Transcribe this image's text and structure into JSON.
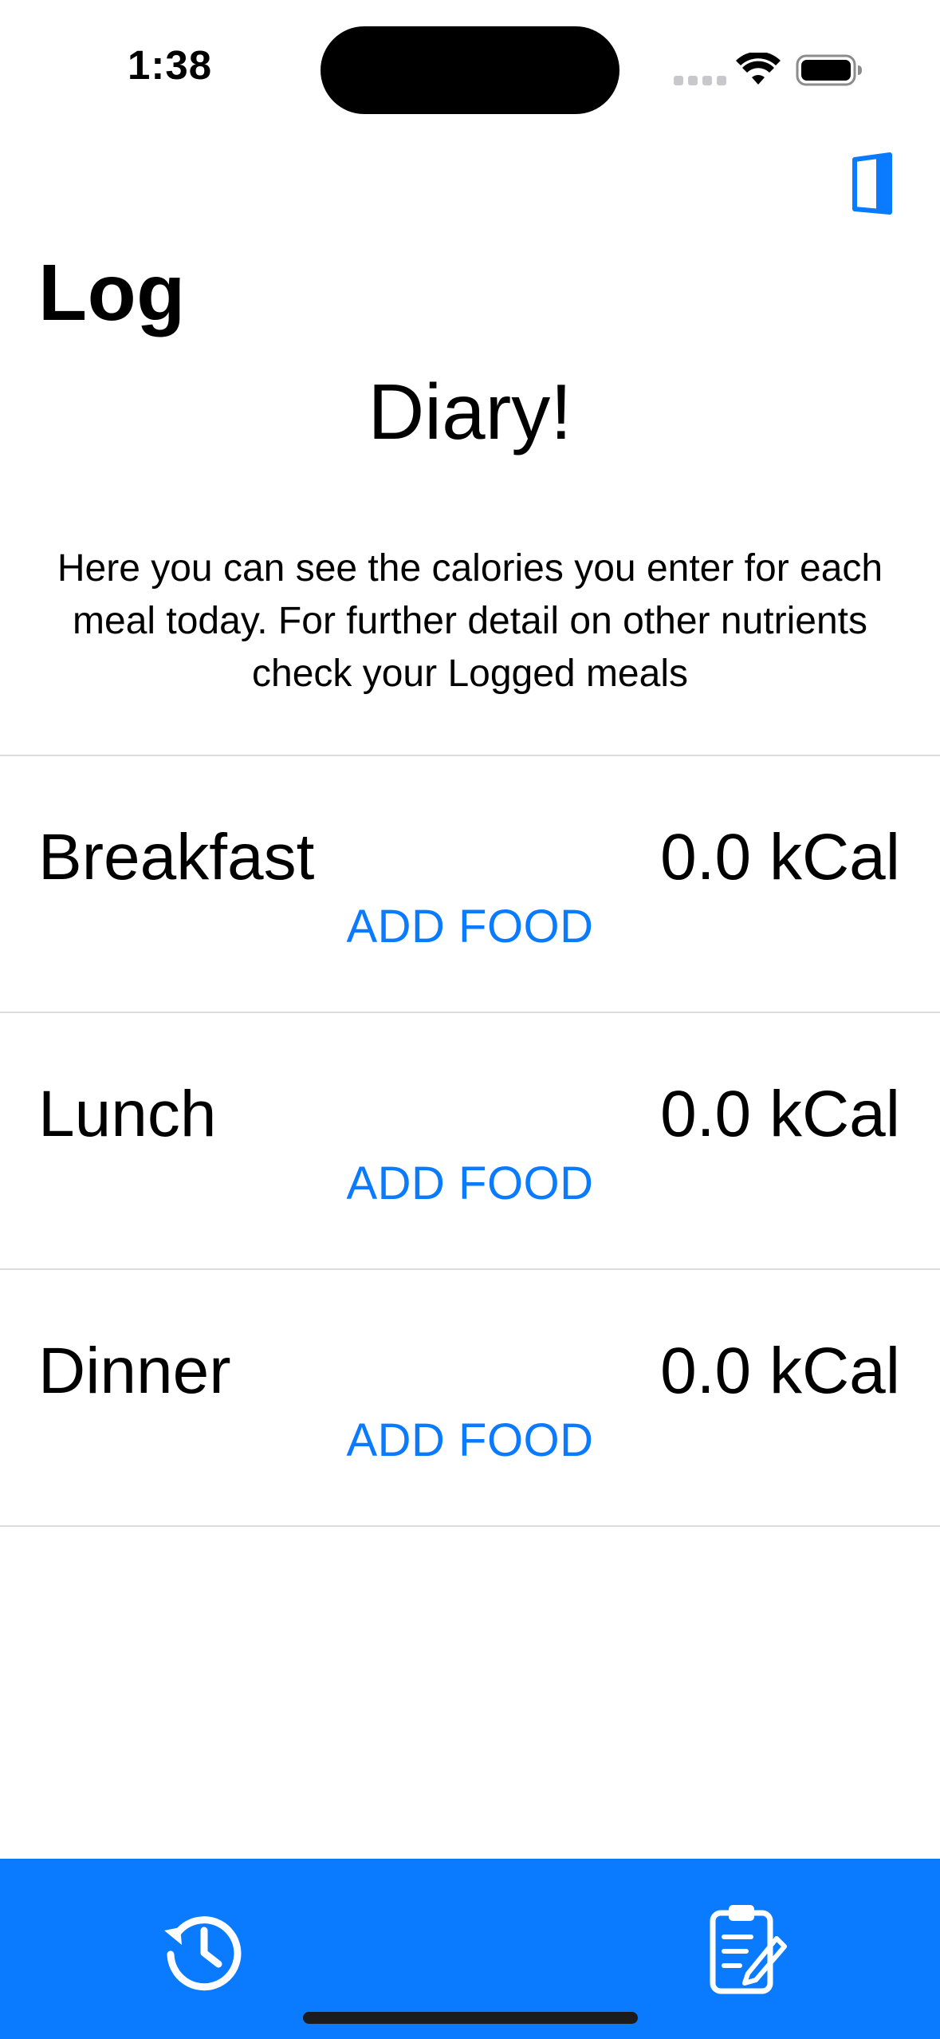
{
  "status_bar": {
    "time": "1:38"
  },
  "nav": {
    "title": "Log",
    "door_icon": "door-exit-icon"
  },
  "diary": {
    "heading": "Diary!",
    "intro": "Here you can see the calories you enter for each meal today. For further detail on other nutrients check your Logged meals"
  },
  "meals": [
    {
      "name": "Breakfast",
      "kcal": "0.0 kCal",
      "add_label": "ADD FOOD"
    },
    {
      "name": "Lunch",
      "kcal": "0.0 kCal",
      "add_label": "ADD FOOD"
    },
    {
      "name": "Dinner",
      "kcal": "0.0 kCal",
      "add_label": "ADD FOOD"
    }
  ],
  "tab_bar": {
    "color": "#0A7AFF",
    "tabs": [
      {
        "icon": "history-icon"
      },
      {
        "icon": "clipboard-edit-icon"
      }
    ]
  }
}
